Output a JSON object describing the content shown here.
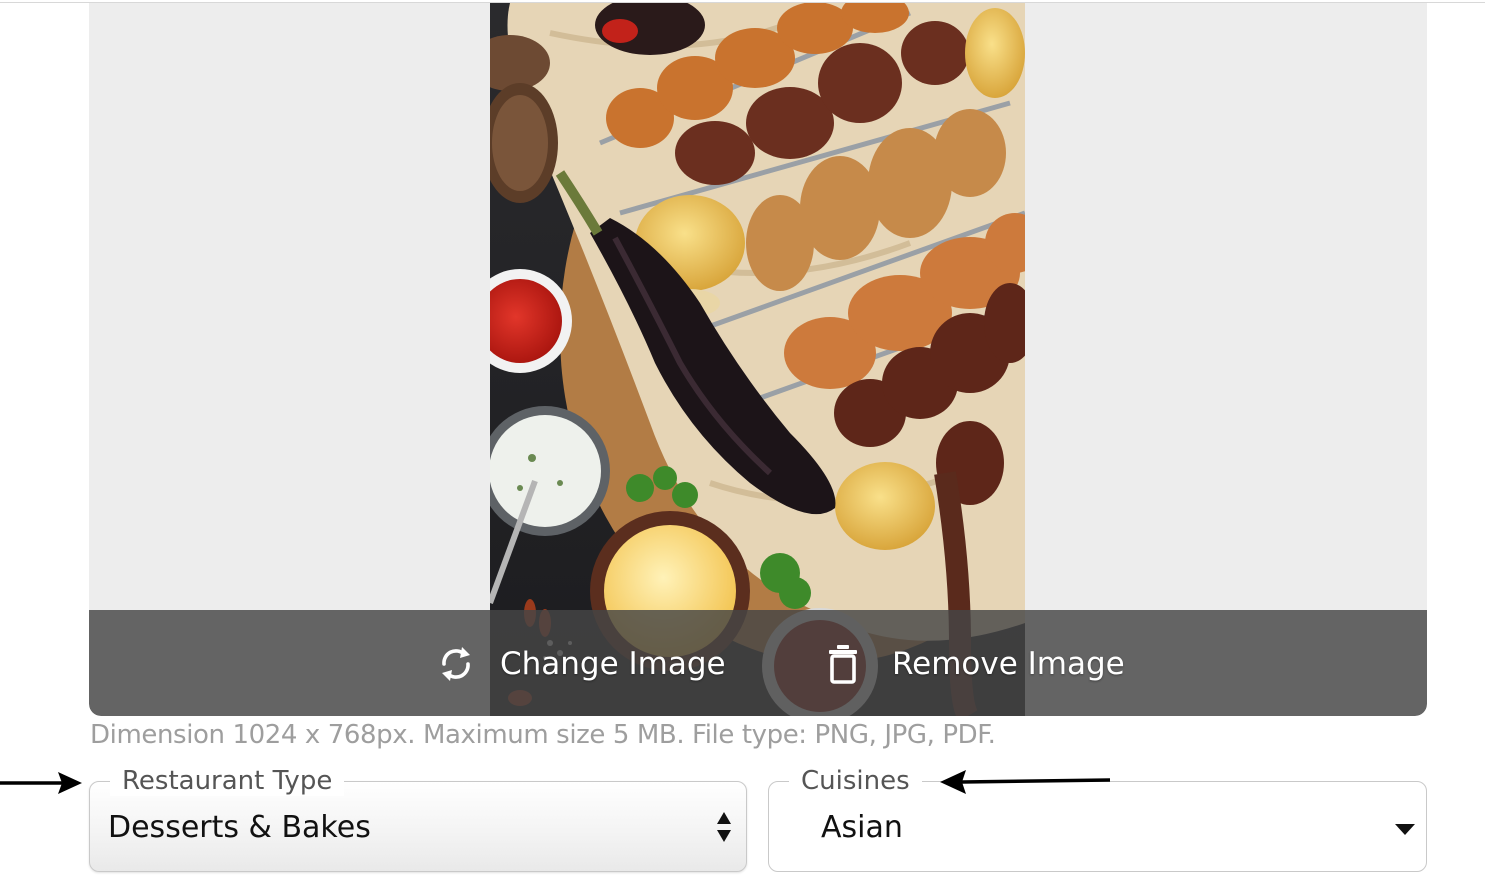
{
  "preview": {
    "change_label": "Change Image",
    "remove_label": "Remove Image",
    "change_icon": "refresh-icon",
    "remove_icon": "trash-icon"
  },
  "hint": "Dimension 1024 x 768px. Maximum size 5 MB. File type: PNG, JPG, PDF.",
  "fields": {
    "restaurant_type": {
      "label": "Restaurant Type",
      "value": "Desserts & Bakes",
      "icon": "updown-chevron-icon"
    },
    "cuisines": {
      "label": "Cuisines",
      "value": "Asian",
      "icon": "caret-down-icon"
    }
  },
  "colors": {
    "overlay": "#464646",
    "hint_text": "#9e9e9e",
    "preview_bg": "#ededed"
  }
}
